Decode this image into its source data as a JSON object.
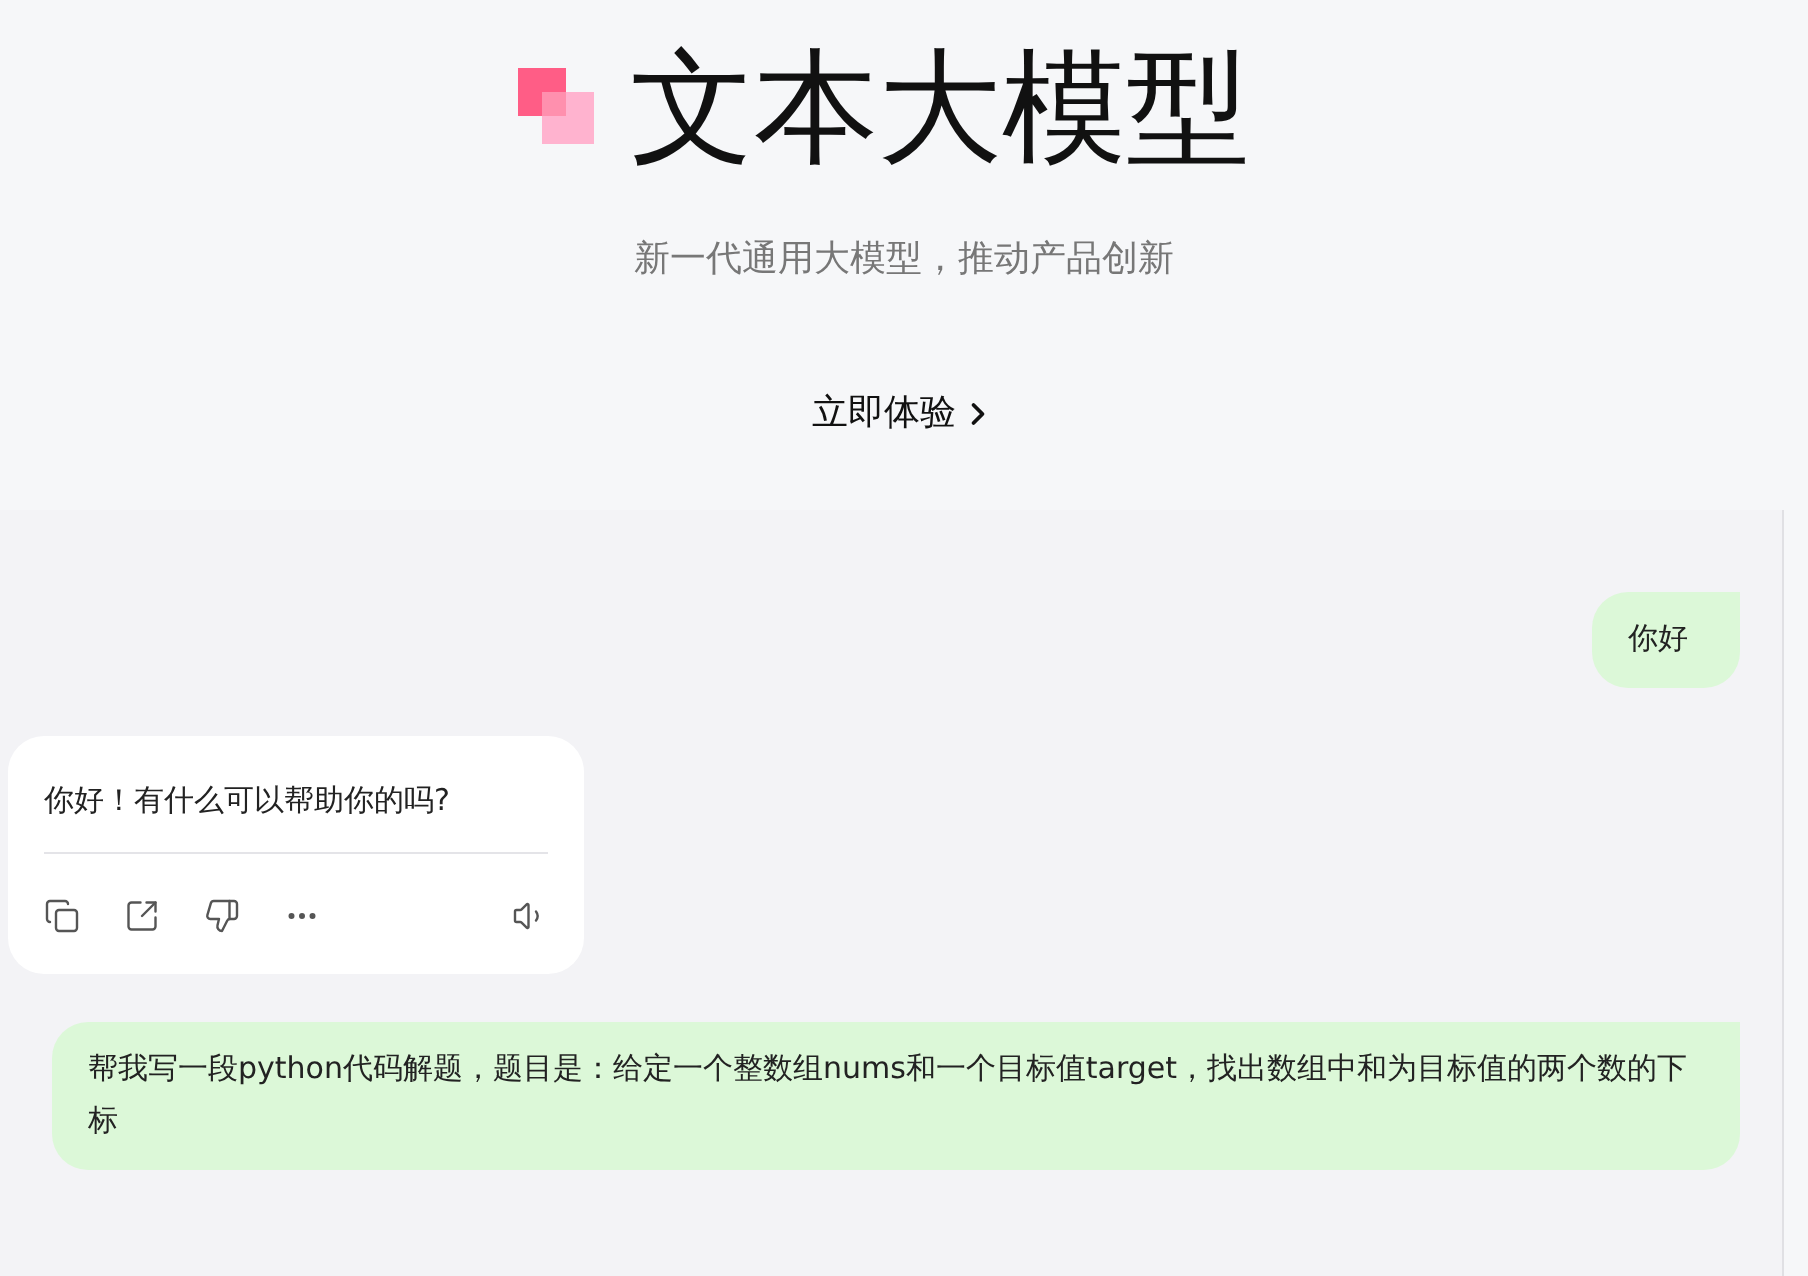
{
  "hero": {
    "title": "文本大模型",
    "subtitle": "新一代通用大模型，推动产品创新",
    "cta": "立即体验"
  },
  "messages": [
    {
      "kind": "user",
      "text": "你好"
    },
    {
      "kind": "assistant",
      "text": "你好！有什么可以帮助你的吗?"
    },
    {
      "kind": "user",
      "text": "帮我写一段python代码解题，题目是：给定一个整数组nums和一个目标值target，找出数组中和为目标值的两个数的下标"
    }
  ]
}
